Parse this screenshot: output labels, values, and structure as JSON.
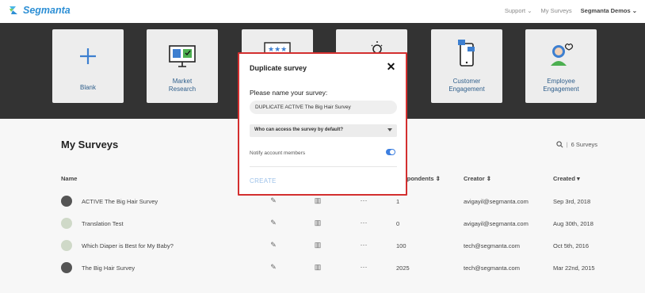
{
  "header": {
    "logo_text": "Segmanta",
    "nav": [
      {
        "label": "Support"
      },
      {
        "label": "My Surveys"
      },
      {
        "label": "Segmanta Demos"
      }
    ]
  },
  "templates": [
    {
      "label": "Blank",
      "icon": "plus-icon"
    },
    {
      "label": "Market\nResearch",
      "icon": "monitor-chart-icon"
    },
    {
      "label": "",
      "icon": "rating-stars-icon"
    },
    {
      "label": "",
      "icon": "lightbulb-icon"
    },
    {
      "label": "Customer\nEngagement",
      "icon": "phone-chat-icon"
    },
    {
      "label": "Employee\nEngagement",
      "icon": "employee-heart-icon"
    }
  ],
  "main": {
    "title": "My Surveys",
    "survey_count": "6 Surveys",
    "columns": {
      "name": "Name",
      "respondents": "Respondents",
      "creator": "Creator",
      "created": "Created"
    },
    "rows": [
      {
        "name": "ACTIVE The Big Hair Survey",
        "respondents": "1",
        "creator": "avigayil@segmanta.com",
        "created": "Sep 3rd, 2018",
        "avatar": "dark"
      },
      {
        "name": "Translation Test",
        "respondents": "0",
        "creator": "avigayil@segmanta.com",
        "created": "Aug 30th, 2018",
        "avatar": "light"
      },
      {
        "name": "Which Diaper is Best for My Baby?",
        "respondents": "100",
        "creator": "tech@segmanta.com",
        "created": "Oct 5th, 2016",
        "avatar": "light"
      },
      {
        "name": "The Big Hair Survey",
        "respondents": "2025",
        "creator": "tech@segmanta.com",
        "created": "Mar 22nd, 2015",
        "avatar": "dark"
      }
    ]
  },
  "modal": {
    "title": "Duplicate survey",
    "prompt": "Please name your survey:",
    "name_value": "DUPLICATE ACTIVE The Big Hair Survey",
    "access_select": "Who can access the survey by default?",
    "notify_label": "Notify account members",
    "notify_on": true,
    "create_label": "CREATE"
  },
  "colors": {
    "brand": "#2d8fd5",
    "band": "#333333",
    "modal_border": "#d32f2f",
    "toggle_on": "#3d7fe0"
  }
}
